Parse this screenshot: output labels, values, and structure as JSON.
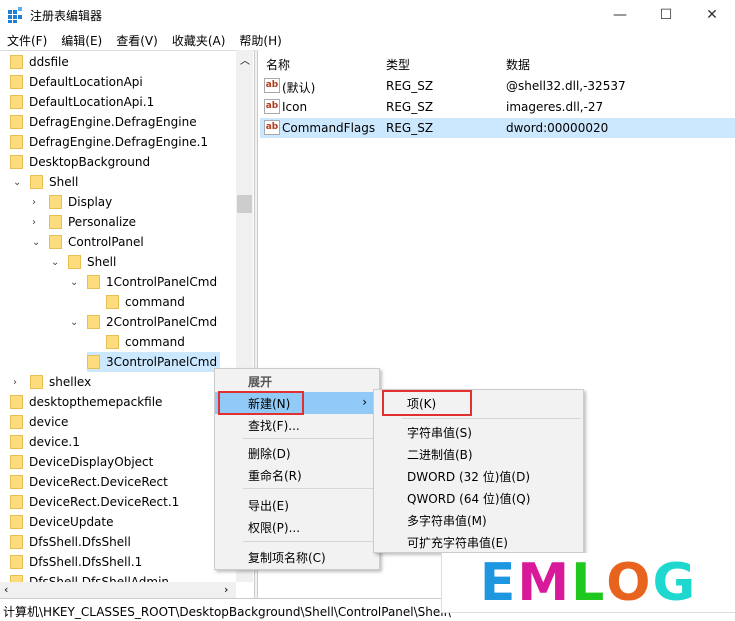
{
  "window": {
    "title": "注册表编辑器",
    "minimize": "—",
    "maximize": "☐",
    "close": "✕"
  },
  "menu": [
    "文件(F)",
    "编辑(E)",
    "查看(V)",
    "收藏夹(A)",
    "帮助(H)"
  ],
  "tree": [
    {
      "label": "ddsfile",
      "level": 0
    },
    {
      "label": "DefaultLocationApi",
      "level": 0
    },
    {
      "label": "DefaultLocationApi.1",
      "level": 0
    },
    {
      "label": "DefragEngine.DefragEngine",
      "level": 0
    },
    {
      "label": "DefragEngine.DefragEngine.1",
      "level": 0
    },
    {
      "label": "DesktopBackground",
      "level": 0
    },
    {
      "label": "Shell",
      "level": 1,
      "expander": "expanded"
    },
    {
      "label": "Display",
      "level": 2,
      "expander": "collapsed"
    },
    {
      "label": "Personalize",
      "level": 2,
      "expander": "collapsed"
    },
    {
      "label": "ControlPanel",
      "level": 2,
      "expander": "expanded"
    },
    {
      "label": "Shell",
      "level": 3,
      "expander": "expanded"
    },
    {
      "label": "1ControlPanelCmd",
      "level": 4,
      "expander": "expanded"
    },
    {
      "label": "command",
      "level": 5
    },
    {
      "label": "2ControlPanelCmd",
      "level": 4,
      "expander": "expanded"
    },
    {
      "label": "command",
      "level": 5
    },
    {
      "label": "3ControlPanelCmd",
      "level": 4,
      "selected": true
    },
    {
      "label": "shellex",
      "level": 1,
      "expander": "collapsed"
    },
    {
      "label": "desktopthemepackfile",
      "level": 0
    },
    {
      "label": "device",
      "level": 0
    },
    {
      "label": "device.1",
      "level": 0
    },
    {
      "label": "DeviceDisplayObject",
      "level": 0
    },
    {
      "label": "DeviceRect.DeviceRect",
      "level": 0
    },
    {
      "label": "DeviceRect.DeviceRect.1",
      "level": 0
    },
    {
      "label": "DeviceUpdate",
      "level": 0
    },
    {
      "label": "DfsShell.DfsShell",
      "level": 0
    },
    {
      "label": "DfsShell.DfsShell.1",
      "level": 0
    },
    {
      "label": "DfsShell.DfsShellAdmin",
      "level": 0
    }
  ],
  "list": {
    "headers": [
      "名称",
      "类型",
      "数据"
    ],
    "rows": [
      {
        "name": "(默认)",
        "type": "REG_SZ",
        "data": "@shell32.dll,-32537"
      },
      {
        "name": "Icon",
        "type": "REG_SZ",
        "data": "imageres.dll,-27"
      },
      {
        "name": "CommandFlags",
        "type": "REG_SZ",
        "data": "dword:00000020",
        "selected": true
      }
    ],
    "value_icon": "ab"
  },
  "status": "计算机\\HKEY_CLASSES_ROOT\\DesktopBackground\\Shell\\ControlPanel\\Shell\\",
  "context_menu": {
    "items": [
      "展开",
      "新建(N)",
      "查找(F)...",
      "删除(D)",
      "重命名(R)",
      "导出(E)",
      "权限(P)...",
      "复制项名称(C)"
    ],
    "highlighted": "新建(N)"
  },
  "submenu": {
    "items": [
      "项(K)",
      "字符串值(S)",
      "二进制值(B)",
      "DWORD (32 位)值(D)",
      "QWORD (64 位)值(Q)",
      "多字符串值(M)",
      "可扩充字符串值(E)"
    ]
  },
  "highlight_color": "#e03030",
  "watermark": {
    "letters": [
      "E",
      "M",
      "L",
      "O",
      "G"
    ],
    "colors": [
      "#1e96e0",
      "#d8199a",
      "#1ec81e",
      "#e8641e",
      "#1ed8d0"
    ]
  }
}
